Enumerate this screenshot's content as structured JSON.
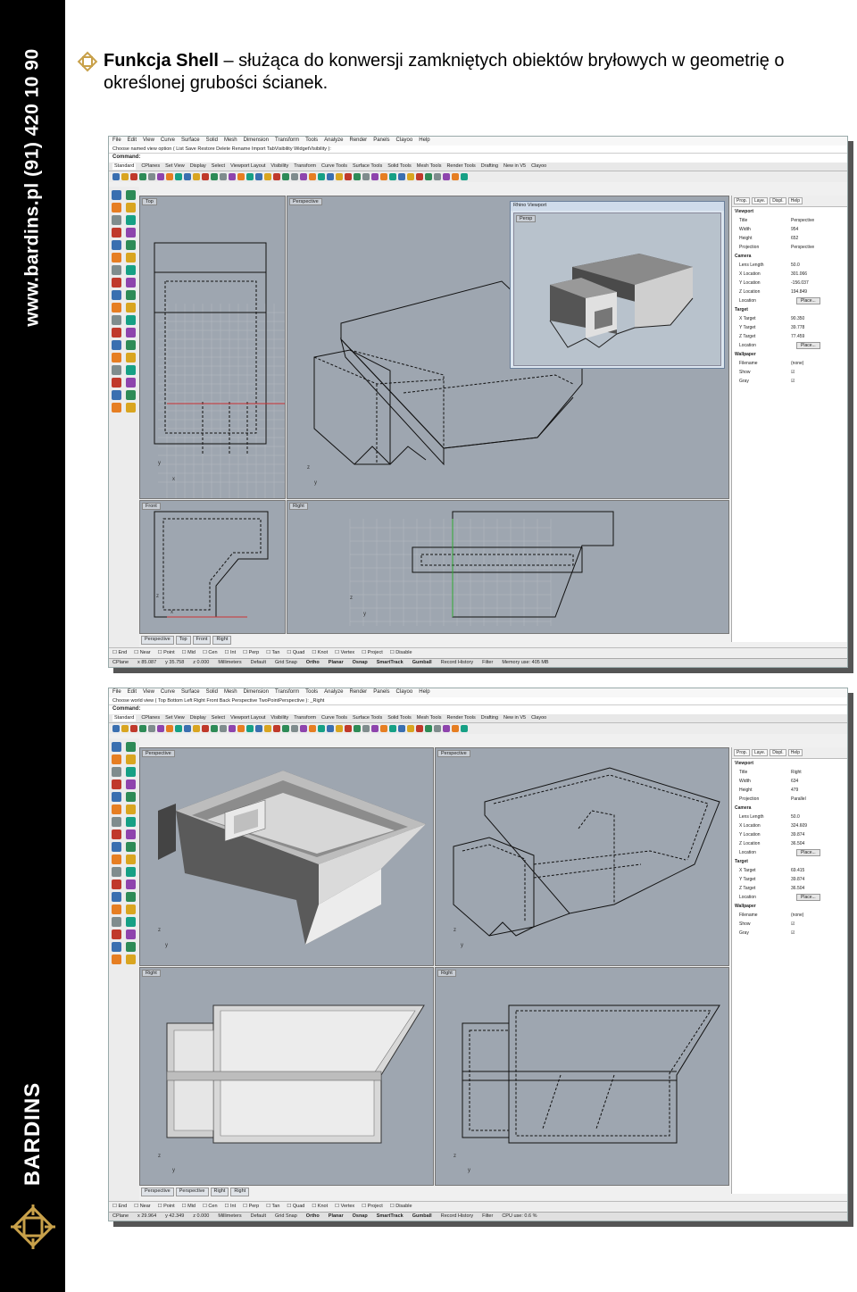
{
  "sidebar": {
    "url_text": "www.bardins.pl  (91) 420 10 90",
    "brand": "BARDINS"
  },
  "heading": {
    "bold": "Funkcja Shell",
    "rest": " – służąca do konwersji zamkniętych obiektów bryłowych w geometrię o określonej grubości ścianek."
  },
  "shot1": {
    "menu": [
      "File",
      "Edit",
      "View",
      "Curve",
      "Surface",
      "Solid",
      "Mesh",
      "Dimension",
      "Transform",
      "Tools",
      "Analyze",
      "Render",
      "Panels",
      "Clayoo",
      "Help"
    ],
    "command_prompt": "Choose named view option ( List Save Restore Delete Rename Import TabVisibility WidgetVisibility ):",
    "command_label": "Command:",
    "tabs": [
      "Standard",
      "CPlanes",
      "Set View",
      "Display",
      "Select",
      "Viewport Layout",
      "Visibility",
      "Transform",
      "Curve Tools",
      "Surface Tools",
      "Solid Tools",
      "Mesh Tools",
      "Render Tools",
      "Drafting",
      "New in V5",
      "Clayoo"
    ],
    "viewports": {
      "top": "Top",
      "perspective": "Perspective",
      "front": "Front",
      "right": "Right"
    },
    "floating_window": {
      "title": "Rhino Viewport",
      "label": "Persp"
    },
    "view_tabs": [
      "Perspective",
      "Top",
      "Front",
      "Right"
    ],
    "panel_tabs": [
      "Prop.",
      "Laye.",
      "Displ.",
      "Help"
    ],
    "panel": {
      "viewport_head": "Viewport",
      "rows1": [
        {
          "k": "Title",
          "v": "Perspective"
        },
        {
          "k": "Width",
          "v": "954"
        },
        {
          "k": "Height",
          "v": "652"
        },
        {
          "k": "Projection",
          "v": "Perspective"
        }
      ],
      "camera_head": "Camera",
      "rows2": [
        {
          "k": "Lens Length",
          "v": "50.0"
        },
        {
          "k": "X Location",
          "v": "301.066"
        },
        {
          "k": "Y Location",
          "v": "-156.037"
        },
        {
          "k": "Z Location",
          "v": "194.849"
        },
        {
          "k": "Location",
          "v": "Place..."
        }
      ],
      "target_head": "Target",
      "rows3": [
        {
          "k": "X Target",
          "v": "90.350"
        },
        {
          "k": "Y Target",
          "v": "39.778"
        },
        {
          "k": "Z Target",
          "v": "77.459"
        },
        {
          "k": "Location",
          "v": "Place..."
        }
      ],
      "wallpaper_head": "Wallpaper",
      "rows4": [
        {
          "k": "Filename",
          "v": "(none)"
        },
        {
          "k": "Show",
          "v": "☑"
        },
        {
          "k": "Gray",
          "v": "☑"
        }
      ]
    },
    "osnap": [
      "End",
      "Near",
      "Point",
      "Mid",
      "Cen",
      "Int",
      "Perp",
      "Tan",
      "Quad",
      "Knot",
      "Vertex",
      "Project",
      "Disable"
    ],
    "status": {
      "cplane": "CPlane",
      "x": "x 85.087",
      "y": "y 35.758",
      "z": "z 0.000",
      "units": "Millimeters",
      "layer": "Default",
      "grid": "Grid Snap",
      "ortho": "Ortho",
      "planar": "Planar",
      "osnap": "Osnap",
      "smart": "SmartTrack",
      "gumball": "Gumball",
      "history": "Record History",
      "filter": "Filter",
      "memory": "Memory use: 405 MB"
    }
  },
  "shot2": {
    "menu": [
      "File",
      "Edit",
      "View",
      "Curve",
      "Surface",
      "Solid",
      "Mesh",
      "Dimension",
      "Transform",
      "Tools",
      "Analyze",
      "Render",
      "Panels",
      "Clayoo",
      "Help"
    ],
    "command_prompt": "Choose world view ( Top Bottom Left Right Front Back Perspective TwoPointPerspective ): _Right",
    "command_label": "Command:",
    "tabs": [
      "Standard",
      "CPlanes",
      "Set View",
      "Display",
      "Select",
      "Viewport Layout",
      "Visibility",
      "Transform",
      "Curve Tools",
      "Surface Tools",
      "Solid Tools",
      "Mesh Tools",
      "Render Tools",
      "Drafting",
      "New in V5",
      "Clayoo"
    ],
    "viewports": {
      "tl": "Perspective",
      "tr": "Perspective",
      "bl": "Right",
      "br": "Right"
    },
    "view_tabs": [
      "Perspective",
      "Perspective",
      "Right",
      "Right"
    ],
    "panel_tabs": [
      "Prop.",
      "Laye.",
      "Displ.",
      "Help"
    ],
    "panel": {
      "viewport_head": "Viewport",
      "rows1": [
        {
          "k": "Title",
          "v": "Right"
        },
        {
          "k": "Width",
          "v": "634"
        },
        {
          "k": "Height",
          "v": "479"
        },
        {
          "k": "Projection",
          "v": "Parallel"
        }
      ],
      "camera_head": "Camera",
      "rows2": [
        {
          "k": "Lens Length",
          "v": "50.0"
        },
        {
          "k": "X Location",
          "v": "324.609"
        },
        {
          "k": "Y Location",
          "v": "39.874"
        },
        {
          "k": "Z Location",
          "v": "36.504"
        },
        {
          "k": "Location",
          "v": "Place..."
        }
      ],
      "target_head": "Target",
      "rows3": [
        {
          "k": "X Target",
          "v": "69.415"
        },
        {
          "k": "Y Target",
          "v": "39.874"
        },
        {
          "k": "Z Target",
          "v": "36.504"
        },
        {
          "k": "Location",
          "v": "Place..."
        }
      ],
      "wallpaper_head": "Wallpaper",
      "rows4": [
        {
          "k": "Filename",
          "v": "(none)"
        },
        {
          "k": "Show",
          "v": "☑"
        },
        {
          "k": "Gray",
          "v": "☑"
        }
      ]
    },
    "osnap": [
      "End",
      "Near",
      "Point",
      "Mid",
      "Cen",
      "Int",
      "Perp",
      "Tan",
      "Quad",
      "Knot",
      "Vertex",
      "Project",
      "Disable"
    ],
    "status": {
      "cplane": "CPlane",
      "x": "x 29.964",
      "y": "y 42.349",
      "z": "z 0.000",
      "units": "Millimeters",
      "layer": "Default",
      "grid": "Grid Snap",
      "ortho": "Ortho",
      "planar": "Planar",
      "osnap": "Osnap",
      "smart": "SmartTrack",
      "gumball": "Gumball",
      "history": "Record History",
      "filter": "Filter",
      "memory": "CPU use: 0.6 %"
    }
  },
  "colors": {
    "sidebar": "#000000",
    "viewport": "#9ea6b0",
    "accent": "#c8a14a"
  }
}
